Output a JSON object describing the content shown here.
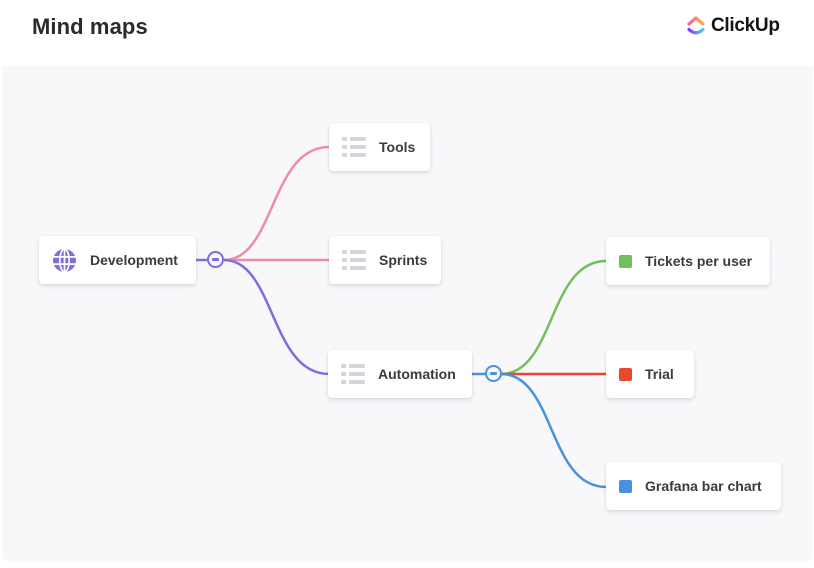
{
  "header": {
    "title": "Mind maps",
    "brand": "ClickUp"
  },
  "colors": {
    "purple": "#7b6fe0",
    "pink": "#f08aad",
    "blue": "#4a90e2",
    "green": "#72c05b",
    "red": "#e8482d"
  },
  "mindmap": {
    "root": {
      "label": "Development",
      "icon": "globe-icon"
    },
    "level1": [
      {
        "label": "Tools",
        "icon": "list-icon"
      },
      {
        "label": "Sprints",
        "icon": "list-icon"
      },
      {
        "label": "Automation",
        "icon": "list-icon"
      }
    ],
    "level2": [
      {
        "label": "Tickets per user",
        "icon": "green-square-icon",
        "color": "#72c05b"
      },
      {
        "label": "Trial",
        "icon": "red-square-icon",
        "color": "#e8482d"
      },
      {
        "label": "Grafana bar chart",
        "icon": "blue-square-icon",
        "color": "#4a90e2"
      }
    ]
  }
}
